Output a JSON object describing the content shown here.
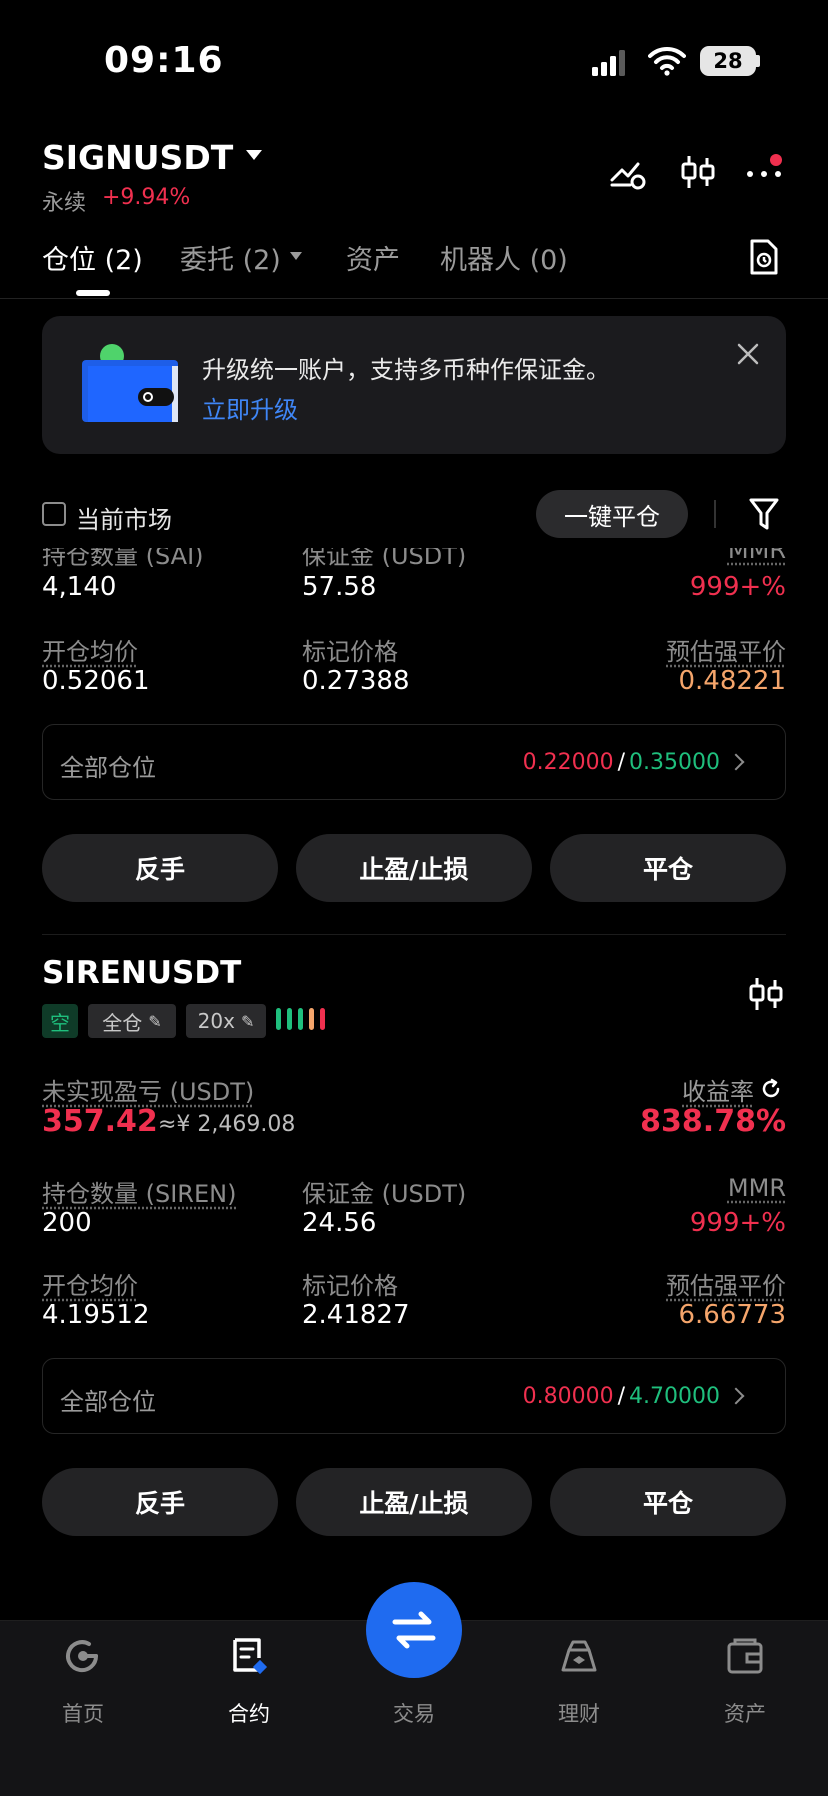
{
  "status_bar": {
    "time": "09:16",
    "battery": "28"
  },
  "header": {
    "symbol": "SIGNUSDT",
    "contract_type": "永续",
    "change": "+9.94%"
  },
  "tabs": [
    {
      "label": "仓位 (2)",
      "active": true
    },
    {
      "label": "委托 (2)",
      "active": false
    },
    {
      "label": "资产",
      "active": false
    },
    {
      "label": "机器人 (0)",
      "active": false
    }
  ],
  "banner": {
    "text": "升级统一账户，支持多币种作保证金。",
    "link": "立即升级"
  },
  "filter": {
    "current_market": "当前市场",
    "close_all": "一键平仓"
  },
  "position1": {
    "qty_label": "持仓数量 (SAI)",
    "qty": "4,140",
    "margin_label": "保证金 (USDT)",
    "margin": "57.58",
    "mmr_label": "MMR",
    "mmr": "999+%",
    "entry_label": "开仓均价",
    "entry": "0.52061",
    "mark_label": "标记价格",
    "mark": "0.27388",
    "liq_label": "预估强平价",
    "liq": "0.48221",
    "range_label": "全部仓位",
    "tp": "0.22000",
    "slash": "/",
    "sl": "0.35000"
  },
  "position2": {
    "symbol": "SIRENUSDT",
    "side": "空",
    "mode": "全仓",
    "leverage": "20x",
    "pnl_label": "未实现盈亏 (USDT)",
    "pnl": "357.42",
    "pnl_cny": "≈¥ 2,469.08",
    "roe_label": "收益率",
    "roe": "838.78%",
    "qty_label": "持仓数量 (SIREN)",
    "qty": "200",
    "margin_label": "保证金 (USDT)",
    "margin": "24.56",
    "mmr_label": "MMR",
    "mmr": "999+%",
    "entry_label": "开仓均价",
    "entry": "4.19512",
    "mark_label": "标记价格",
    "mark": "2.41827",
    "liq_label": "预估强平价",
    "liq": "6.66773",
    "range_label": "全部仓位",
    "tp": "0.80000",
    "slash": "/",
    "sl": "4.70000"
  },
  "actions": {
    "reverse": "反手",
    "tpsl": "止盈/止损",
    "close": "平仓"
  },
  "risk_bar_colors": [
    "#1fbf7d",
    "#1fbf7d",
    "#1fbf7d",
    "#f5a56b",
    "#f0304f"
  ],
  "nav": [
    {
      "label": "首页",
      "icon": "home-icon"
    },
    {
      "label": "合约",
      "icon": "contract-icon",
      "active": true
    },
    {
      "label": "交易",
      "icon": "swap-icon"
    },
    {
      "label": "理财",
      "icon": "finance-icon"
    },
    {
      "label": "资产",
      "icon": "wallet-icon"
    }
  ]
}
